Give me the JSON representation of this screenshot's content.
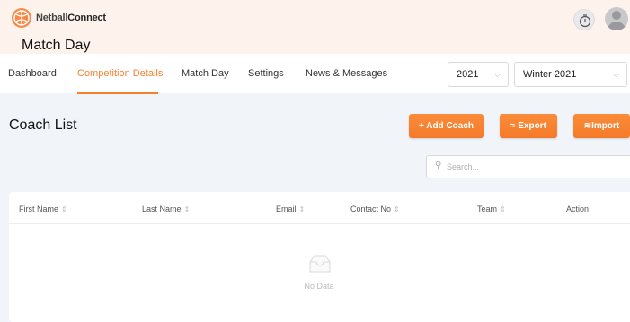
{
  "app": {
    "brand_part1": "Netball",
    "brand_part2": "Connect",
    "page_heading": "Match Day"
  },
  "nav": {
    "items": [
      {
        "label": "Dashboard"
      },
      {
        "label": "Competition Details"
      },
      {
        "label": "Match Day"
      },
      {
        "label": "Settings"
      },
      {
        "label": "News & Messages"
      }
    ],
    "active": "Competition Details"
  },
  "filters": {
    "year": "2021",
    "competition": "Winter 2021"
  },
  "main": {
    "title": "Coach List",
    "buttons": {
      "add_coach": "+ Add Coach",
      "export": "Export",
      "import": "Import"
    },
    "search": {
      "placeholder": "Search..."
    }
  },
  "table": {
    "columns": [
      "First Name",
      "Last Name",
      "Email",
      "Contact No",
      "Team",
      "Action"
    ],
    "empty_text": "No Data"
  },
  "colors": {
    "accent": "#f5812e",
    "header_bg": "#fdf3ec",
    "page_bg": "#f1f5f9"
  },
  "icons": {
    "logo": "netball-logo-icon",
    "timer": "stopwatch-icon",
    "avatar": "user-avatar-icon",
    "sort": "sort-icon",
    "empty": "inbox-empty-icon"
  }
}
